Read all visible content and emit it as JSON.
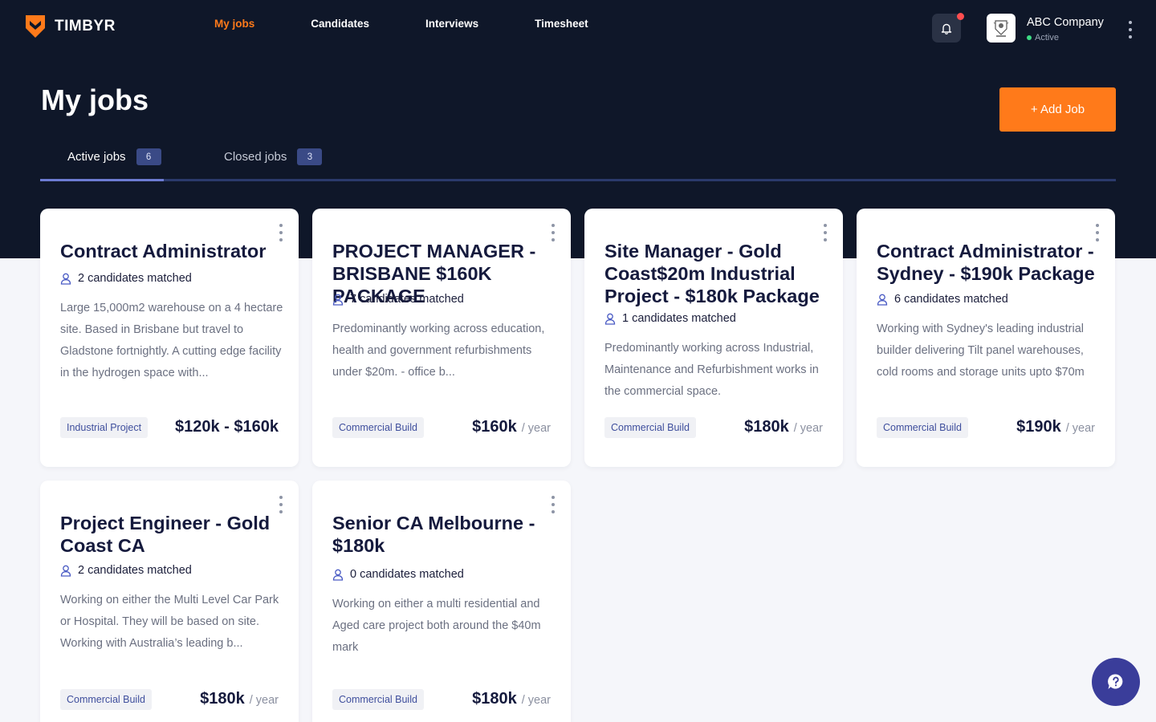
{
  "brand": {
    "name": "TIMBYR",
    "accent": "#ff7a1a",
    "nav_bg": "#0f1729"
  },
  "nav": {
    "items": [
      {
        "label": "My jobs",
        "active": true
      },
      {
        "label": "Candidates",
        "active": false
      },
      {
        "label": "Interviews",
        "active": false
      },
      {
        "label": "Timesheet",
        "active": false
      }
    ]
  },
  "header": {
    "notification_icon": "bell-icon",
    "notification_unread": true,
    "company": {
      "name": "ABC Company",
      "status": "Active"
    }
  },
  "page": {
    "title": "My jobs",
    "add_job_label": "+ Add Job"
  },
  "tabs": [
    {
      "label": "Active jobs",
      "count": "6",
      "active": true
    },
    {
      "label": "Closed jobs",
      "count": "3",
      "active": false
    }
  ],
  "jobs": [
    {
      "title": "Contract Administrator",
      "matched": "2 candidates matched",
      "description": "Large 15,000m2 warehouse on a 4 hectare site. Based in Brisbane but travel to Gladstone fortnightly. A cutting edge facility in the hydrogen space with...",
      "tag": "Industrial Project",
      "salary": "$120k - $160k",
      "period": ""
    },
    {
      "title": "PROJECT MANAGER - BRISBANE $160K PACKAGE",
      "matched": "7 candidates matched",
      "description": "Predominantly working across education, health and government refurbishments under $20m. - office b...",
      "tag": "Commercial Build",
      "salary": "$160k",
      "period": "/ year"
    },
    {
      "title": "Site Manager - Gold Coast$20m Industrial Project - $180k Package",
      "matched": "1 candidates matched",
      "description": "Predominantly working across Industrial, Maintenance and Refurbishment works in the commercial space.",
      "tag": "Commercial Build",
      "salary": "$180k",
      "period": "/ year"
    },
    {
      "title": "Contract Administrator - Sydney - $190k Package",
      "matched": "6 candidates matched",
      "description": "Working with Sydney's leading industrial builder delivering Tilt panel warehouses, cold rooms and storage units upto $70m",
      "tag": "Commercial Build",
      "salary": "$190k",
      "period": "/ year"
    },
    {
      "title": "Project Engineer - Gold Coast CA",
      "matched": "2 candidates matched",
      "description": "Working on either the Multi Level Car Park or Hospital. They will be based on site. Working with Australia’s leading b...",
      "tag": "Commercial Build",
      "salary": "$180k",
      "period": "/ year"
    },
    {
      "title": "Senior CA Melbourne - $180k",
      "matched": "0 candidates matched",
      "description": "Working on either a multi residential and Aged care project both around the $40m mark",
      "tag": "Commercial Build",
      "salary": "$180k",
      "period": "/ year"
    }
  ],
  "help": {
    "icon": "help-chat-icon"
  }
}
